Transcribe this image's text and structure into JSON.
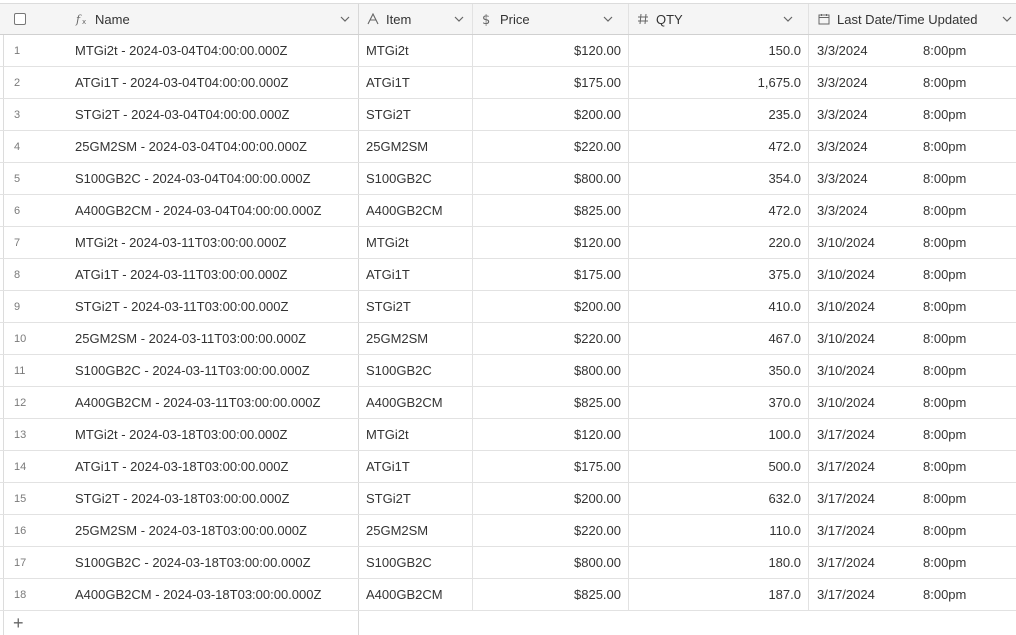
{
  "columns": {
    "name": "Name",
    "item": "Item",
    "price": "Price",
    "qty": "QTY",
    "date": "Last Date/Time Updated"
  },
  "icons": {
    "name": "formula-icon",
    "item": "text-icon",
    "price": "currency-icon",
    "qty": "number-icon",
    "date": "calendar-icon"
  },
  "rows": [
    {
      "num": "1",
      "name": "MTGi2t - 2024-03-04T04:00:00.000Z",
      "item": "MTGi2t",
      "price": "$120.00",
      "qty": "150.0",
      "date": "3/3/2024",
      "time": "8:00pm"
    },
    {
      "num": "2",
      "name": "ATGi1T - 2024-03-04T04:00:00.000Z",
      "item": "ATGi1T",
      "price": "$175.00",
      "qty": "1,675.0",
      "date": "3/3/2024",
      "time": "8:00pm"
    },
    {
      "num": "3",
      "name": "STGi2T - 2024-03-04T04:00:00.000Z",
      "item": "STGi2T",
      "price": "$200.00",
      "qty": "235.0",
      "date": "3/3/2024",
      "time": "8:00pm"
    },
    {
      "num": "4",
      "name": "25GM2SM - 2024-03-04T04:00:00.000Z",
      "item": "25GM2SM",
      "price": "$220.00",
      "qty": "472.0",
      "date": "3/3/2024",
      "time": "8:00pm"
    },
    {
      "num": "5",
      "name": "S100GB2C - 2024-03-04T04:00:00.000Z",
      "item": "S100GB2C",
      "price": "$800.00",
      "qty": "354.0",
      "date": "3/3/2024",
      "time": "8:00pm"
    },
    {
      "num": "6",
      "name": "A400GB2CM - 2024-03-04T04:00:00.000Z",
      "item": "A400GB2CM",
      "price": "$825.00",
      "qty": "472.0",
      "date": "3/3/2024",
      "time": "8:00pm"
    },
    {
      "num": "7",
      "name": "MTGi2t - 2024-03-11T03:00:00.000Z",
      "item": "MTGi2t",
      "price": "$120.00",
      "qty": "220.0",
      "date": "3/10/2024",
      "time": "8:00pm"
    },
    {
      "num": "8",
      "name": "ATGi1T - 2024-03-11T03:00:00.000Z",
      "item": "ATGi1T",
      "price": "$175.00",
      "qty": "375.0",
      "date": "3/10/2024",
      "time": "8:00pm"
    },
    {
      "num": "9",
      "name": "STGi2T - 2024-03-11T03:00:00.000Z",
      "item": "STGi2T",
      "price": "$200.00",
      "qty": "410.0",
      "date": "3/10/2024",
      "time": "8:00pm"
    },
    {
      "num": "10",
      "name": "25GM2SM - 2024-03-11T03:00:00.000Z",
      "item": "25GM2SM",
      "price": "$220.00",
      "qty": "467.0",
      "date": "3/10/2024",
      "time": "8:00pm"
    },
    {
      "num": "11",
      "name": "S100GB2C - 2024-03-11T03:00:00.000Z",
      "item": "S100GB2C",
      "price": "$800.00",
      "qty": "350.0",
      "date": "3/10/2024",
      "time": "8:00pm"
    },
    {
      "num": "12",
      "name": "A400GB2CM - 2024-03-11T03:00:00.000Z",
      "item": "A400GB2CM",
      "price": "$825.00",
      "qty": "370.0",
      "date": "3/10/2024",
      "time": "8:00pm"
    },
    {
      "num": "13",
      "name": "MTGi2t - 2024-03-18T03:00:00.000Z",
      "item": "MTGi2t",
      "price": "$120.00",
      "qty": "100.0",
      "date": "3/17/2024",
      "time": "8:00pm"
    },
    {
      "num": "14",
      "name": "ATGi1T - 2024-03-18T03:00:00.000Z",
      "item": "ATGi1T",
      "price": "$175.00",
      "qty": "500.0",
      "date": "3/17/2024",
      "time": "8:00pm"
    },
    {
      "num": "15",
      "name": "STGi2T - 2024-03-18T03:00:00.000Z",
      "item": "STGi2T",
      "price": "$200.00",
      "qty": "632.0",
      "date": "3/17/2024",
      "time": "8:00pm"
    },
    {
      "num": "16",
      "name": "25GM2SM - 2024-03-18T03:00:00.000Z",
      "item": "25GM2SM",
      "price": "$220.00",
      "qty": "110.0",
      "date": "3/17/2024",
      "time": "8:00pm"
    },
    {
      "num": "17",
      "name": "S100GB2C - 2024-03-18T03:00:00.000Z",
      "item": "S100GB2C",
      "price": "$800.00",
      "qty": "180.0",
      "date": "3/17/2024",
      "time": "8:00pm"
    },
    {
      "num": "18",
      "name": "A400GB2CM - 2024-03-18T03:00:00.000Z",
      "item": "A400GB2CM",
      "price": "$825.00",
      "qty": "187.0",
      "date": "3/17/2024",
      "time": "8:00pm"
    }
  ],
  "add_row_label": "+"
}
